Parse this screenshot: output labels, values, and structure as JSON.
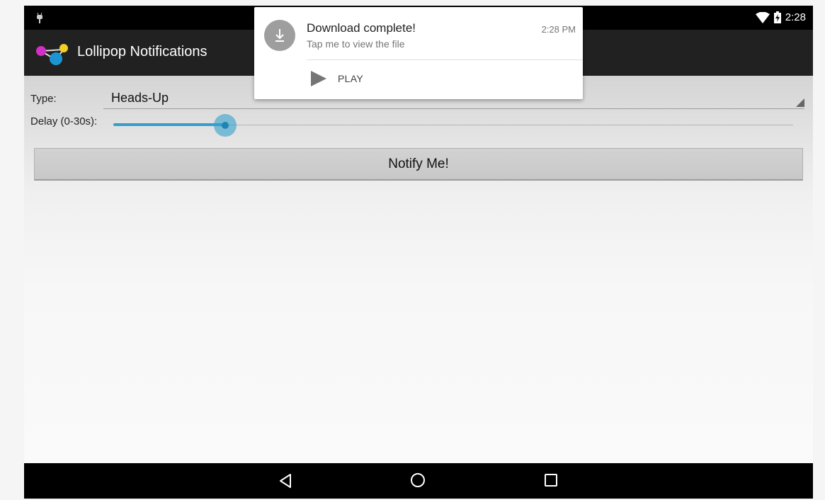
{
  "status_bar": {
    "time": "2:28",
    "icons": [
      "android-debug-icon",
      "wifi-icon",
      "battery-charging-icon"
    ]
  },
  "action_bar": {
    "title": "Lollipop Notifications",
    "logo": "app-logo-molecule-icon"
  },
  "form": {
    "type_label": "Type:",
    "type_value": "Heads-Up",
    "delay_label": "Delay (0-30s):",
    "delay_fraction": 0.165,
    "notify_button": "Notify Me!"
  },
  "notification": {
    "title": "Download complete!",
    "time": "2:28 PM",
    "text": "Tap me to view the file",
    "icon": "download-icon",
    "action_label": "PLAY",
    "action_icon": "play-icon"
  },
  "nav_bar": {
    "icons": [
      "back-icon",
      "home-icon",
      "recents-icon"
    ]
  },
  "colors": {
    "accent": "#33a0cc",
    "action_bar": "#212121",
    "status_bar": "#000000"
  }
}
